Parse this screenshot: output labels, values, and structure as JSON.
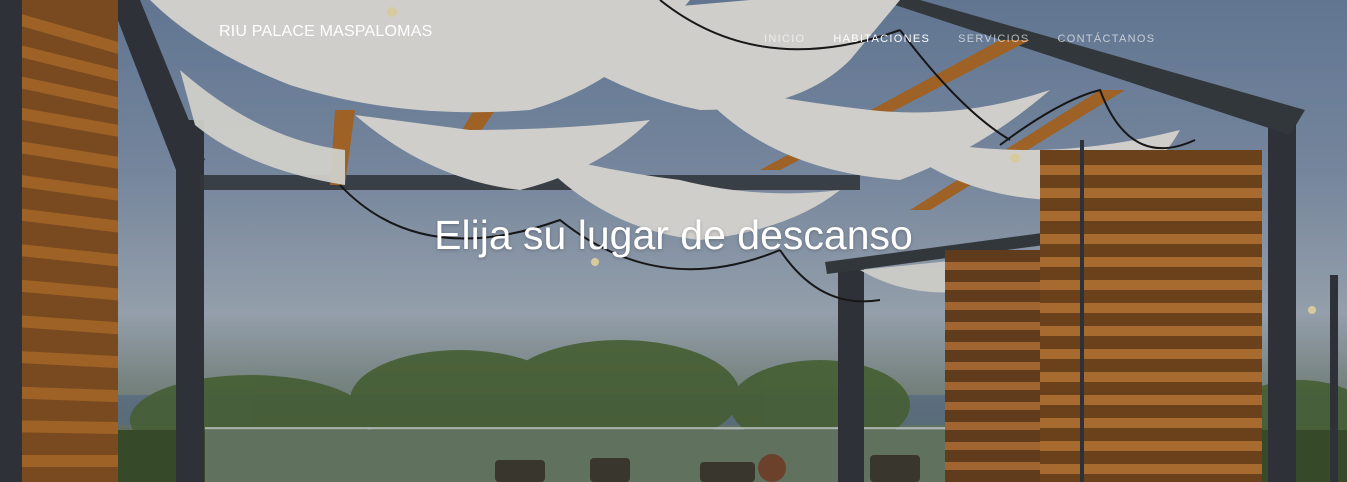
{
  "header": {
    "brand": "RIU PALACE MASPALOMAS",
    "nav": [
      {
        "label": "INICIO",
        "active": false
      },
      {
        "label": "HABITACIONES",
        "active": true
      },
      {
        "label": "SERVICIOS",
        "active": false
      },
      {
        "label": "CONTÁCTANOS",
        "active": false
      }
    ]
  },
  "hero": {
    "headline": "Elija su lugar de descanso",
    "image_subject": "rooftop terrace with wooden pergola, white canopy shades, string lights and palm trees"
  },
  "colors": {
    "nav_active": "#ffffff",
    "nav_inactive": "rgba(255,255,255,0.62)",
    "wood": "#b4702c",
    "canopy": "#ecebe6",
    "frame": "#3a3f45"
  }
}
